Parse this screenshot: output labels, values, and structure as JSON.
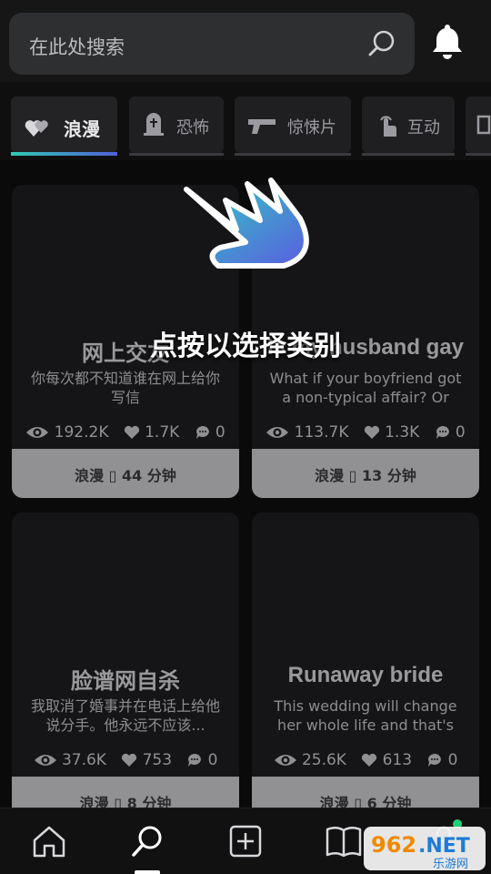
{
  "search": {
    "placeholder": "在此处搜索"
  },
  "tabs": [
    {
      "label": "浪漫",
      "icon": "hearts-icon",
      "active": true
    },
    {
      "label": "恐怖",
      "icon": "tombstone-icon",
      "active": false
    },
    {
      "label": "惊悚片",
      "icon": "pistol-icon",
      "active": false
    },
    {
      "label": "互动",
      "icon": "tap-hand-icon",
      "active": false
    }
  ],
  "cards": [
    {
      "title": "网上交友",
      "desc": "你每次都不知道谁在网上给你写信",
      "views": "192.2K",
      "likes": "1.7K",
      "comments": "0",
      "meta": "浪漫 ▯ 44 分钟"
    },
    {
      "title": "Is my husband gay",
      "desc": "What if your boyfriend got a non-typical affair? Or di...",
      "views": "113.7K",
      "likes": "1.3K",
      "comments": "0",
      "meta": "浪漫 ▯ 13 分钟"
    },
    {
      "title": "脸谱网自杀",
      "desc": "我取消了婚事并在电话上给他说分手。他永远不应该...",
      "views": "37.6K",
      "likes": "753",
      "comments": "0",
      "meta": "浪漫 ▯ 8 分钟"
    },
    {
      "title": "Runaway bride",
      "desc": "This wedding will change her whole life and that's w...",
      "views": "25.6K",
      "likes": "613",
      "comments": "0",
      "meta": "浪漫 ▯ 6 分钟"
    }
  ],
  "hint": {
    "text": "点按以选择类别"
  },
  "colors": {
    "accent_start": "#30c9b4",
    "accent_end": "#5060d8",
    "online_dot": "#20d07a"
  },
  "nav": [
    "home-icon",
    "search-icon",
    "add-icon",
    "library-icon",
    "profile-icon"
  ],
  "watermark": {
    "text": "962.NET",
    "sub": "乐游网"
  }
}
